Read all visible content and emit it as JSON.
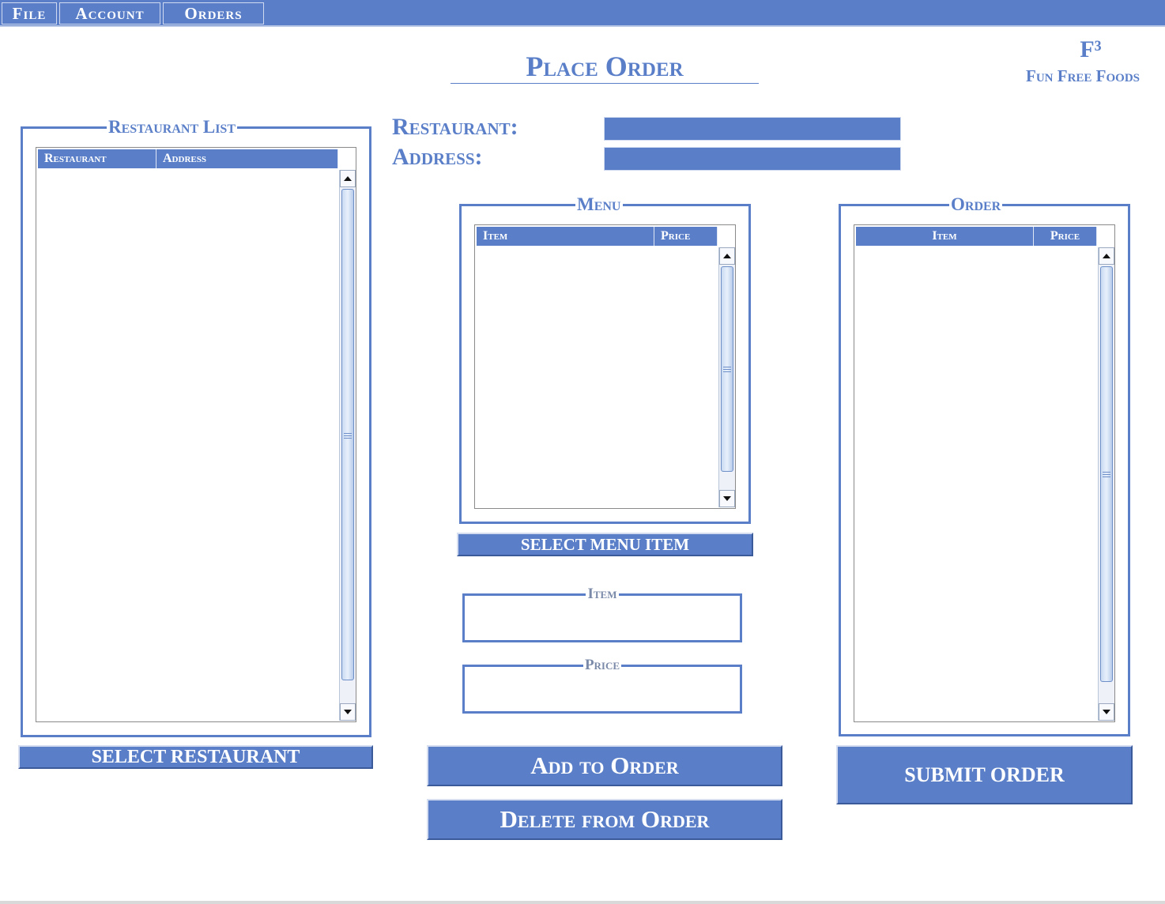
{
  "menu": {
    "file": "File",
    "account": "Account",
    "orders": "Orders"
  },
  "page_title": "Place Order",
  "brand": {
    "logo": "F³",
    "name": "Fun Free Foods"
  },
  "restaurant_list": {
    "legend": "Restaurant List",
    "columns": [
      "Restaurant",
      "Address"
    ],
    "select_button": "SELECT RESTAURANT"
  },
  "details": {
    "restaurant_label": "Restaurant:",
    "address_label": "Address:",
    "restaurant_value": "",
    "address_value": ""
  },
  "menu_panel": {
    "legend": "Menu",
    "columns": [
      "Item",
      "Price"
    ],
    "select_button": "SELECT MENU ITEM"
  },
  "item_box": {
    "legend": "Item",
    "value": ""
  },
  "price_box": {
    "legend": "Price",
    "value": ""
  },
  "order_panel": {
    "legend": "Order",
    "columns": [
      "Item",
      "Price"
    ]
  },
  "buttons": {
    "add": "Add to Order",
    "delete": "Delete from Order",
    "submit": "SUBMIT ORDER"
  },
  "colors": {
    "accent": "#5a7fc8",
    "background": "#ffffff"
  }
}
